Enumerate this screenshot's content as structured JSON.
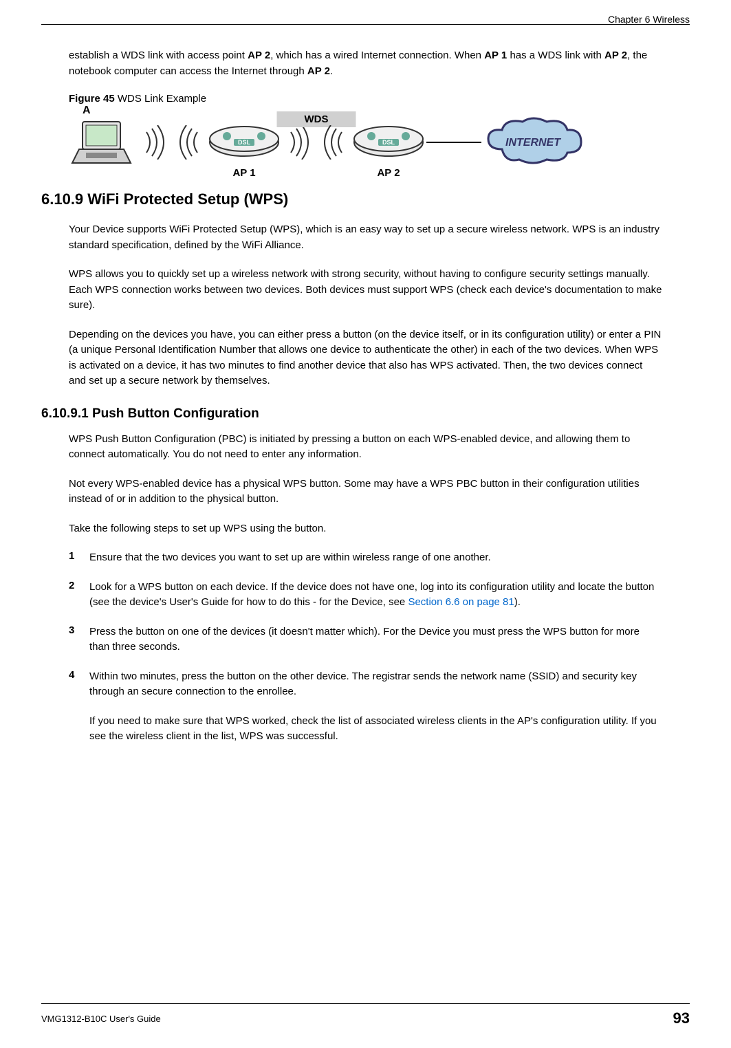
{
  "header": {
    "chapter": "Chapter 6 Wireless"
  },
  "intro_para": {
    "part1": "establish a WDS link with access point ",
    "ap2_1": "AP 2",
    "part2": ", which has a wired Internet connection. When ",
    "ap1": "AP 1",
    "part3": " has a WDS link with ",
    "ap2_2": "AP 2",
    "part4": ", the notebook computer can access the Internet through ",
    "ap2_3": "AP 2",
    "part5": "."
  },
  "figure": {
    "label": "Figure 45",
    "title": "   WDS Link Example"
  },
  "diagram": {
    "label_a": "A",
    "wds_label": "WDS",
    "ap1_label": "AP 1",
    "ap2_label": "AP 2",
    "internet_label": "INTERNET",
    "dsl_label": "DSL"
  },
  "section": {
    "number": "6.10.9",
    "title": "  WiFi Protected Setup (WPS)"
  },
  "wps_para1": "Your Device supports WiFi Protected Setup (WPS), which is an easy way to set up a secure wireless network. WPS is an industry standard specification, defined by the WiFi Alliance.",
  "wps_para2": "WPS allows you to quickly set up a wireless network with strong security, without having to configure security settings manually. Each WPS connection works between two devices. Both devices must support WPS (check each device's documentation to make sure).",
  "wps_para3": "Depending on the devices you have, you can either press a button (on the device itself, or in its configuration utility) or enter a PIN (a unique Personal Identification Number that allows one device to authenticate the other) in each of the two devices. When WPS is activated on a device, it has two minutes to find another device that also has WPS activated. Then, the two devices connect and set up a secure network by themselves.",
  "subsection": {
    "number": "6.10.9.1",
    "title": "  Push Button Configuration"
  },
  "pbc_para1": "WPS Push Button Configuration (PBC) is initiated by pressing a button on each WPS-enabled device, and allowing them to connect automatically. You do not need to enter any information.",
  "pbc_para2": "Not every WPS-enabled device has a physical WPS button. Some may have a WPS PBC button in their configuration utilities instead of or in addition to the physical button.",
  "pbc_para3": "Take the following steps to set up WPS using the button.",
  "steps": [
    {
      "num": "1",
      "text": "Ensure that the two devices you want to set up are within wireless range of one another."
    },
    {
      "num": "2",
      "text_part1": "Look for a WPS button on each device. If the device does not have one, log into its configuration utility and locate the button (see the device's User's Guide for how to do this - for the Device, see ",
      "link": "Section 6.6 on page 81",
      "text_part2": ")."
    },
    {
      "num": "3",
      "text": "Press the button on one of the devices (it doesn't matter which). For the Device you must press the WPS button for more than three seconds."
    },
    {
      "num": "4",
      "text": "Within two minutes, press the button on the other device. The registrar sends the network name (SSID) and security key through an secure connection to the enrollee."
    }
  ],
  "closing_para": "If you need to make sure that WPS worked, check the list of associated wireless clients in the AP's configuration utility. If you see the wireless client in the list, WPS was successful.",
  "footer": {
    "guide": "VMG1312-B10C User's Guide",
    "page": "93"
  }
}
